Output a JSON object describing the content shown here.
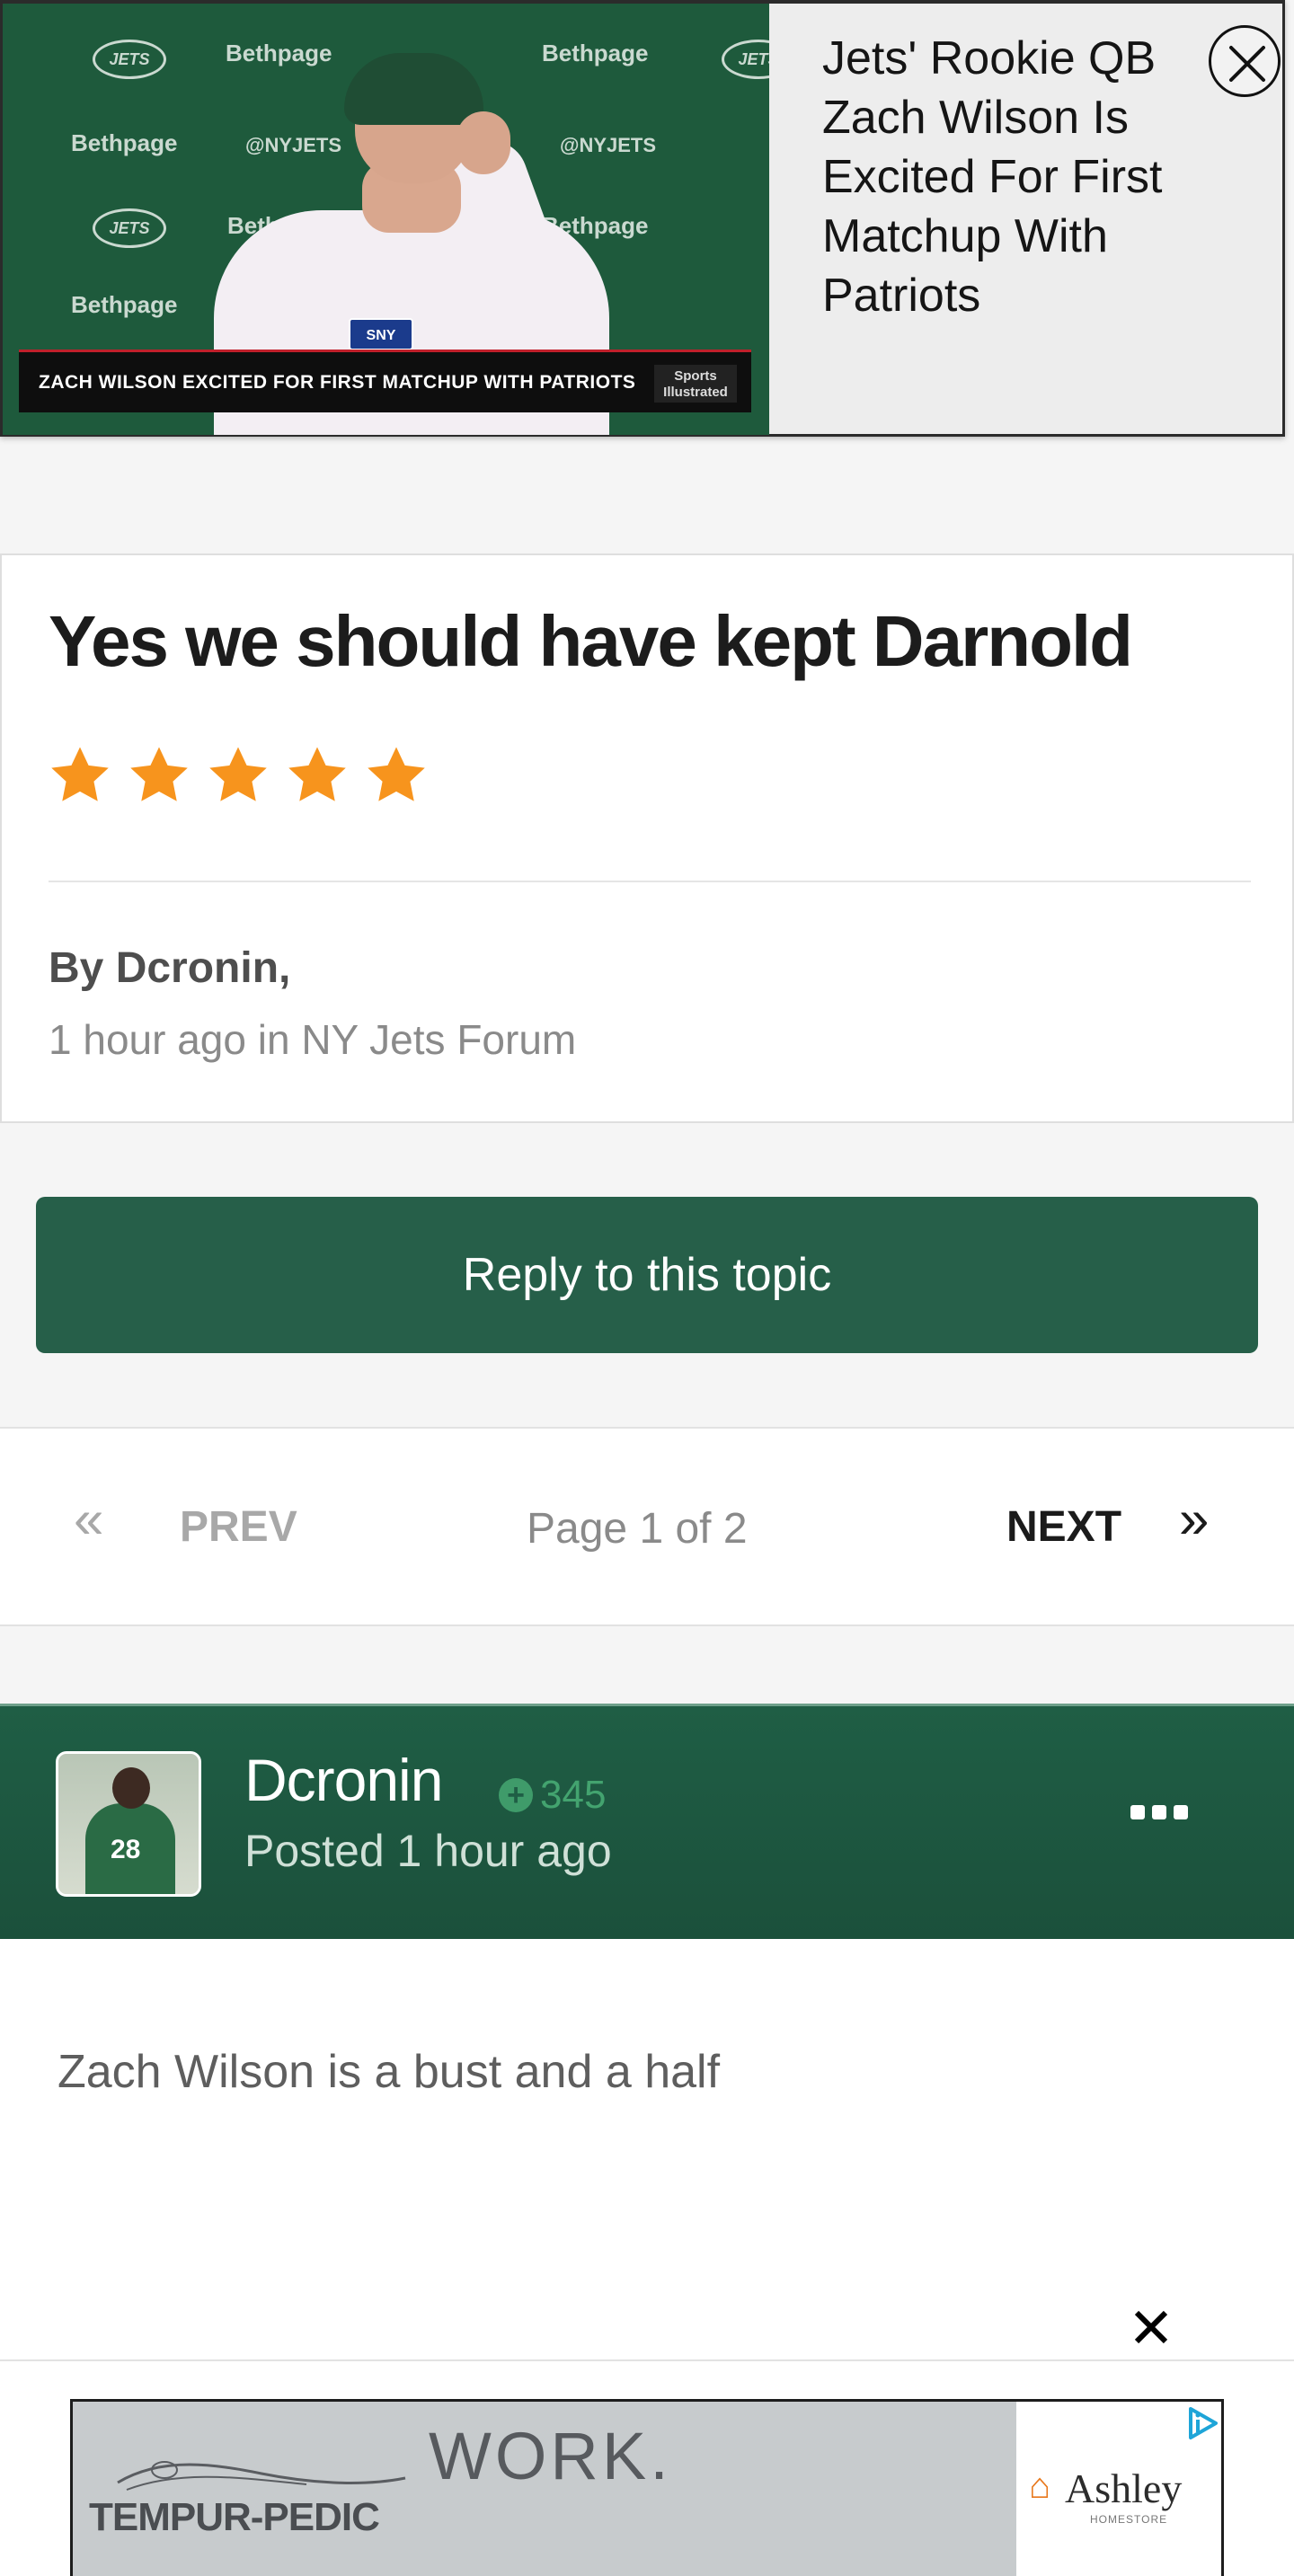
{
  "video": {
    "title": "Jets' Rookie QB Zach Wilson Is Excited For First Matchup With Patriots",
    "caption": "ZACH WILSON EXCITED FOR FIRST MATCHUP WITH PATRIOTS",
    "backdrop_sponsor": "Bethpage",
    "backdrop_handle": "@NYJETS",
    "team_logo_text": "JETS",
    "network_logo": "SNY",
    "publisher_logo": "Sports Illustrated",
    "close_icon": "close-circle-icon"
  },
  "topic": {
    "title": "Yes we should have kept Darnold",
    "rating": 5,
    "rating_max": 5,
    "author_line": "By Dcronin,",
    "meta": "1 hour ago in NY Jets Forum",
    "star_color": "#f7941d"
  },
  "reply_button": {
    "label": "Reply to this topic",
    "color": "#265f49"
  },
  "pagination": {
    "first_symbol": "«",
    "prev_label": "PREV",
    "current": "Page 1 of 2",
    "next_label": "NEXT",
    "last_symbol": "»"
  },
  "post": {
    "username": "Dcronin",
    "reputation": "345",
    "posted": "Posted 1 hour ago",
    "content": "Zach Wilson is a bust and a half",
    "header_color": "#1f5e45",
    "avatar_jersey_number": "28"
  },
  "ad": {
    "headline": "WORK.",
    "brand_left": "TEMPUR-PEDIC",
    "brand_right": "Ashley",
    "brand_right_sub": "HOMESTORE",
    "close_icon": "close-x-icon",
    "adchoices_icon": "adchoices-icon"
  }
}
